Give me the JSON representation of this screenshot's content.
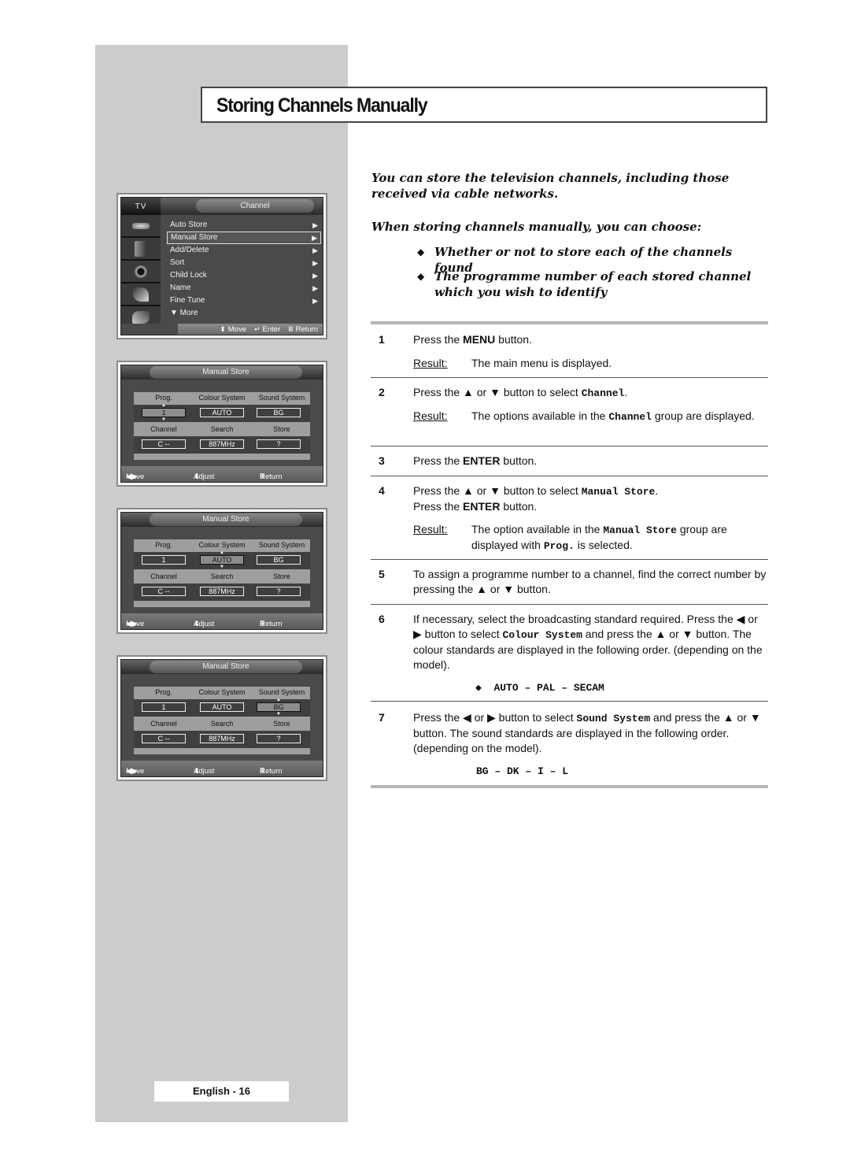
{
  "page": {
    "title": "Storing Channels Manually",
    "footer": "English - 16"
  },
  "osd_channel_menu": {
    "tv_label": "TV",
    "title": "Channel",
    "sidebar_icons": [
      "antenna-icon",
      "tv-screen-icon",
      "speaker-icon",
      "plug-icon",
      "tools-icon"
    ],
    "items": [
      {
        "label": "Auto Store",
        "arrow": "▶"
      },
      {
        "label": "Manual Store",
        "arrow": "▶",
        "selected": true
      },
      {
        "label": "Add/Delete",
        "arrow": "▶"
      },
      {
        "label": "Sort",
        "arrow": "▶"
      },
      {
        "label": "Child Lock",
        "arrow": "▶"
      },
      {
        "label": "Name",
        "arrow": "▶"
      },
      {
        "label": "Fine Tune",
        "arrow": "▶"
      },
      {
        "label": "▼  More",
        "arrow": ""
      }
    ],
    "footer": {
      "move": "Move",
      "enter": "Enter",
      "return": "Return",
      "move_glyph": "⬍",
      "enter_glyph": "↵",
      "return_glyph": "Ⅲ"
    }
  },
  "osd_manual_store": [
    {
      "title": "Manual Store",
      "headers": [
        "Prog.",
        "Colour System",
        "Sound System"
      ],
      "row1": [
        "1",
        "AUTO",
        "BG"
      ],
      "headers2": [
        "Channel",
        "Search",
        "Store"
      ],
      "row2": [
        "C  --",
        "887MHz",
        "?"
      ],
      "selected_field": "Prog.",
      "footer": {
        "move": "Move",
        "adjust": "Adjust",
        "return": "Return",
        "move_glyph": "◀▶",
        "adjust_glyph": "⬍",
        "return_glyph": "Ⅲ"
      }
    },
    {
      "title": "Manual Store",
      "headers": [
        "Prog.",
        "Colour System",
        "Sound System"
      ],
      "row1": [
        "1",
        "AUTO",
        "BG"
      ],
      "headers2": [
        "Channel",
        "Search",
        "Store"
      ],
      "row2": [
        "C  --",
        "887MHz",
        "?"
      ],
      "selected_field": "Colour System",
      "footer": {
        "move": "Move",
        "adjust": "Adjust",
        "return": "Return",
        "move_glyph": "◀▶",
        "adjust_glyph": "⬍",
        "return_glyph": "Ⅲ"
      }
    },
    {
      "title": "Manual Store",
      "headers": [
        "Prog.",
        "Colour System",
        "Sound System"
      ],
      "row1": [
        "1",
        "AUTO",
        "BG"
      ],
      "headers2": [
        "Channel",
        "Search",
        "Store"
      ],
      "row2": [
        "C  --",
        "887MHz",
        "?"
      ],
      "selected_field": "Sound System",
      "footer": {
        "move": "Move",
        "adjust": "Adjust",
        "return": "Return",
        "move_glyph": "◀▶",
        "adjust_glyph": "⬍",
        "return_glyph": "Ⅲ"
      }
    }
  ],
  "intro": {
    "para1": "You can store the television channels, including those received via cable networks.",
    "para2": "When storing channels manually, you can choose:",
    "bullets": [
      "Whether or not to store each of the channels found",
      "The programme number of each stored channel which you wish to identify"
    ],
    "bullet_glyph": "◆"
  },
  "steps": [
    {
      "num": "1",
      "pre": "Press the ",
      "bold": "MENU",
      "post": " button.",
      "result_label": "Result:",
      "result": "The main menu is displayed."
    },
    {
      "num": "2",
      "pre": "Press the ▲ or ▼ button to select ",
      "mono": "Channel",
      "post": ".",
      "result_label": "Result:",
      "result_pre": "The options available in the ",
      "result_mono": "Channel",
      "result_post": " group are displayed."
    },
    {
      "num": "3",
      "pre": "Press the ",
      "bold": "ENTER",
      "post": " button."
    },
    {
      "num": "4",
      "pre": "Press the ▲ or ▼ button to select ",
      "mono": "Manual Store",
      "post": ".",
      "line2_pre": "Press the ",
      "line2_bold": "ENTER",
      "line2_post": " button.",
      "result_label": "Result:",
      "result_pre": "The option available in the ",
      "result_mono": "Manual Store",
      "result_mid": " group are displayed with ",
      "result_mono2": "Prog.",
      "result_post": " is selected."
    },
    {
      "num": "5",
      "text": "To assign a programme number to a channel, find the correct number by pressing the ▲ or ▼ button."
    },
    {
      "num": "6",
      "pre": "If necessary, select the broadcasting standard required. Press the ◀ or ▶ button to select ",
      "mono": "Colour System",
      "post": " and press the ▲ or ▼ button. The colour standards are displayed in the following order. (depending on the model).",
      "sequence": "AUTO – PAL – SECAM",
      "sequence_glyph": "◆"
    },
    {
      "num": "7",
      "pre": "Press the ◀ or ▶ button to select ",
      "mono": "Sound System",
      "post": " and press the ▲ or ▼ button. The sound standards are displayed in the following order. (depending on the model).",
      "sequence": "BG – DK – I – L"
    }
  ]
}
